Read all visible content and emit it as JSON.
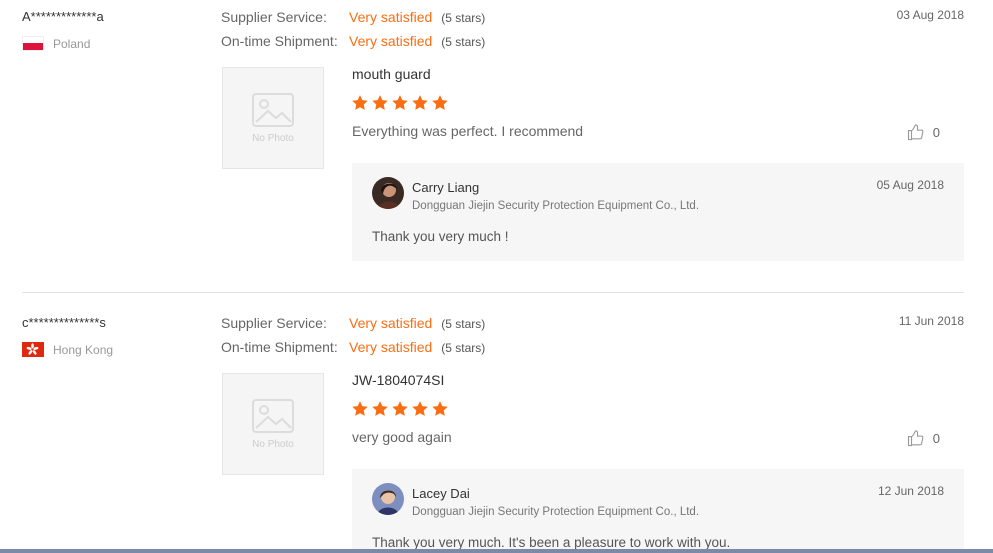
{
  "reviews": [
    {
      "buyer": "A*************a",
      "country": "Poland",
      "date": "03 Aug 2018",
      "ratings": [
        {
          "label": "Supplier Service:",
          "value": "Very satisfied",
          "stars": "(5 stars)"
        },
        {
          "label": "On-time Shipment:",
          "value": "Very satisfied",
          "stars": "(5 stars)"
        }
      ],
      "photo_placeholder": "No Photo",
      "product": "mouth guard",
      "star_rating": 5,
      "comment": "Everything was perfect. I recommend",
      "likes": "0",
      "reply": {
        "name": "Carry Liang",
        "company": "Dongguan Jiejin Security Protection Equipment Co., Ltd.",
        "date": "05 Aug 2018",
        "text": "Thank you very much !"
      }
    },
    {
      "buyer": "c**************s",
      "country": "Hong Kong",
      "date": "11 Jun 2018",
      "ratings": [
        {
          "label": "Supplier Service:",
          "value": "Very satisfied",
          "stars": "(5 stars)"
        },
        {
          "label": "On-time Shipment:",
          "value": "Very satisfied",
          "stars": "(5 stars)"
        }
      ],
      "photo_placeholder": "No Photo",
      "product": "JW-1804074SI",
      "star_rating": 5,
      "comment": "very good again",
      "likes": "0",
      "reply": {
        "name": "Lacey Dai",
        "company": "Dongguan Jiejin Security Protection Equipment Co., Ltd.",
        "date": "12 Jun 2018",
        "text": "Thank you very much. It's been a pleasure to work with you."
      }
    }
  ],
  "colors": {
    "accent": "#f96e13",
    "reply_bg": "#f6f6f6",
    "divider": "#e3e3e3"
  },
  "icons": [
    "poland-flag-icon",
    "hong-kong-flag-icon",
    "no-photo-icon",
    "star-icon",
    "thumbs-up-icon",
    "avatar"
  ]
}
